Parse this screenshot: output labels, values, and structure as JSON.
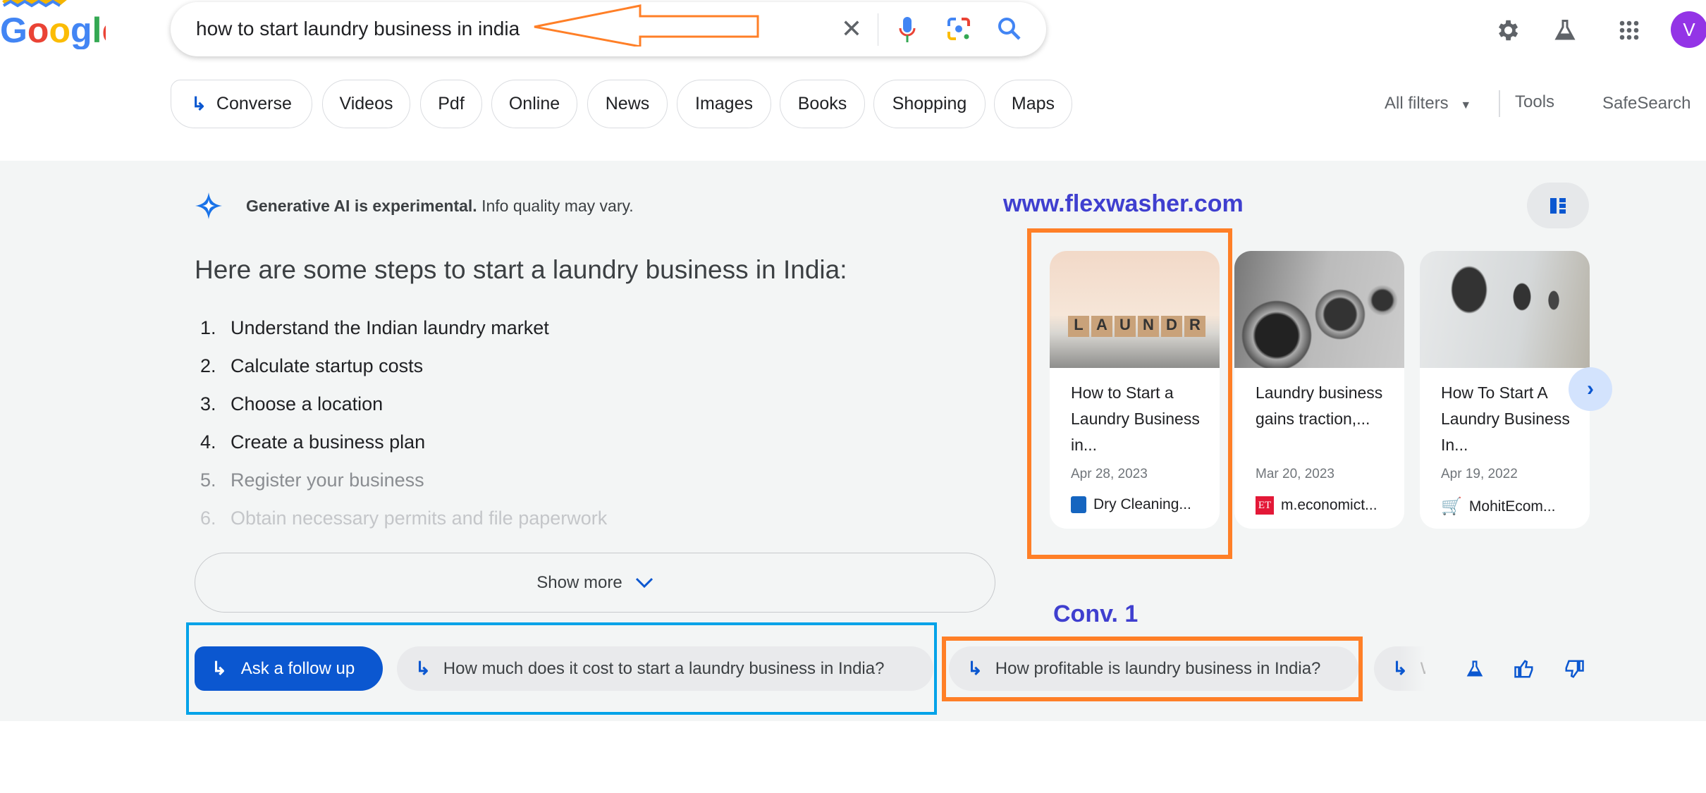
{
  "logo": {
    "text": "Google"
  },
  "search": {
    "query": "how to start laundry business in india",
    "icons": [
      "close-icon",
      "mic-icon",
      "lens-icon",
      "search-icon"
    ]
  },
  "header_icons": [
    "gear-icon",
    "labs-flask-icon",
    "apps-grid-icon"
  ],
  "avatar": {
    "letter": "V",
    "color": "#9334e6"
  },
  "chips": [
    "Converse",
    "Videos",
    "Pdf",
    "Online",
    "News",
    "Images",
    "Books",
    "Shopping",
    "Maps"
  ],
  "filters": {
    "all_filters": "All filters",
    "tools": "Tools",
    "safesearch": "SafeSearch"
  },
  "ai": {
    "notice_bold": "Generative AI is experimental.",
    "notice_rest": " Info quality may vary.",
    "heading": "Here are some steps to start a laundry business in India:",
    "steps": [
      "Understand the Indian laundry market",
      "Calculate startup costs",
      "Choose a location",
      "Create a business plan",
      "Register your business",
      "Obtain necessary permits and file paperwork"
    ],
    "show_more": "Show more"
  },
  "annotations": {
    "site": "www.flexwasher.com",
    "conv": "Conv. 1",
    "accent_orange": "#ff7f27",
    "accent_blue_box": "#00a2e8",
    "label_color": "#3f3fcf"
  },
  "cards": [
    {
      "title": "How to Start a Laundry Business in...",
      "date": "Apr 28, 2023",
      "source": "Dry Cleaning..."
    },
    {
      "title": "Laundry business gains traction,...",
      "date": "Mar 20, 2023",
      "source": "m.economict..."
    },
    {
      "title": "How To Start A Laundry Business In...",
      "date": "Apr 19, 2022",
      "source": "MohitEcom..."
    }
  ],
  "followups": {
    "ask": "Ask a follow up",
    "suggestions": [
      "How much does it cost to start a laundry business in India?",
      "How profitable is laundry business in India?",
      "W"
    ]
  },
  "feedback_icons": [
    "labs-flask-icon",
    "thumbs-up-icon",
    "thumbs-down-icon"
  ]
}
